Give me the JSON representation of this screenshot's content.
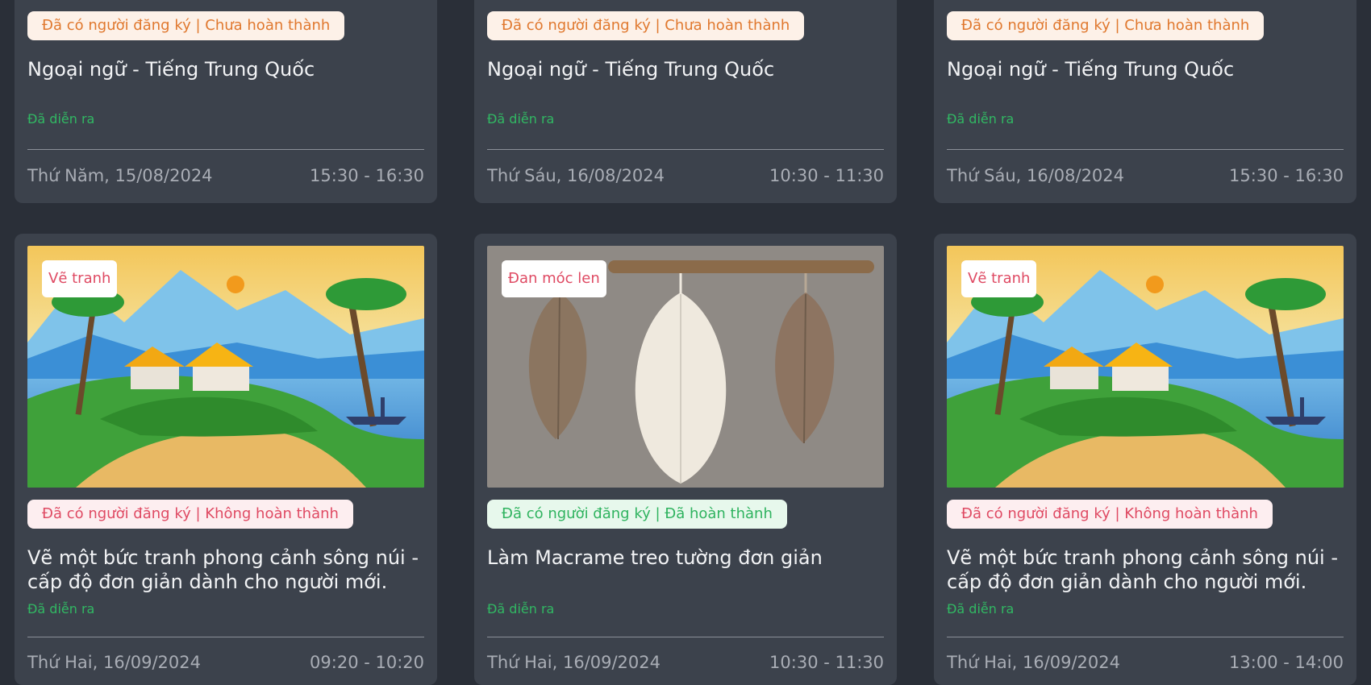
{
  "colors": {
    "page_bg": "#2a2f38",
    "card_bg": "#3c424c",
    "status_orange": "#e0782e",
    "status_red": "#df4a63",
    "status_green": "#2fb35f",
    "occurred_green": "#31b863"
  },
  "cards": [
    {
      "status": "Đã có người đăng ký | Chưa hoàn thành",
      "title": "Ngoại ngữ - Tiếng Trung Quốc",
      "state": "Đã diễn ra",
      "date": "Thứ Năm, 15/08/2024",
      "time": "15:30 - 16:30"
    },
    {
      "status": "Đã có người đăng ký | Chưa hoàn thành",
      "title": "Ngoại ngữ - Tiếng Trung Quốc",
      "state": "Đã diễn ra",
      "date": "Thứ Sáu, 16/08/2024",
      "time": "10:30 - 11:30"
    },
    {
      "status": "Đã có người đăng ký | Chưa hoàn thành",
      "title": "Ngoại ngữ - Tiếng Trung Quốc",
      "state": "Đã diễn ra",
      "date": "Thứ Sáu, 16/08/2024",
      "time": "15:30 - 16:30"
    },
    {
      "category": "Vẽ tranh",
      "image": "landscape-painting-image",
      "status": "Đã có người đăng ký | Không hoàn thành",
      "title": "Vẽ một bức tranh phong cảnh sông núi - cấp độ đơn giản dành cho người mới.",
      "state": "Đã diễn ra",
      "date": "Thứ Hai, 16/09/2024",
      "time": "09:20 - 10:20"
    },
    {
      "category": "Đan móc len",
      "image": "macrame-leaves-image",
      "status": "Đã có người đăng ký | Đã hoàn thành",
      "title": "Làm Macrame treo tường đơn giản",
      "state": "Đã diễn ra",
      "date": "Thứ Hai, 16/09/2024",
      "time": "10:30 - 11:30"
    },
    {
      "category": "Vẽ tranh",
      "image": "landscape-painting-image",
      "status": "Đã có người đăng ký | Không hoàn thành",
      "title": "Vẽ một bức tranh phong cảnh sông núi - cấp độ đơn giản dành cho người mới.",
      "state": "Đã diễn ra",
      "date": "Thứ Hai, 16/09/2024",
      "time": "13:00 - 14:00"
    }
  ]
}
